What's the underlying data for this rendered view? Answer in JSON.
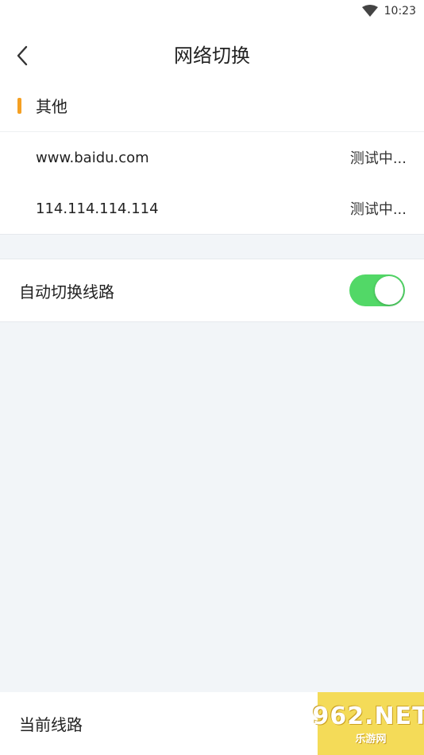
{
  "status_bar": {
    "time": "10:23",
    "icon": "wifi-icon"
  },
  "header": {
    "title": "网络切换",
    "back_icon": "chevron-left-icon"
  },
  "section": {
    "title": "其他",
    "accent_color": "#f5a023",
    "rows": [
      {
        "host": "www.baidu.com",
        "status": "测试中..."
      },
      {
        "host": "114.114.114.114",
        "status": "测试中..."
      }
    ]
  },
  "auto_switch": {
    "label": "自动切换线路",
    "enabled": true,
    "color": "#52d867"
  },
  "bottom": {
    "label": "当前线路"
  },
  "watermark": {
    "main": "962.NET",
    "sub": "乐游网"
  }
}
